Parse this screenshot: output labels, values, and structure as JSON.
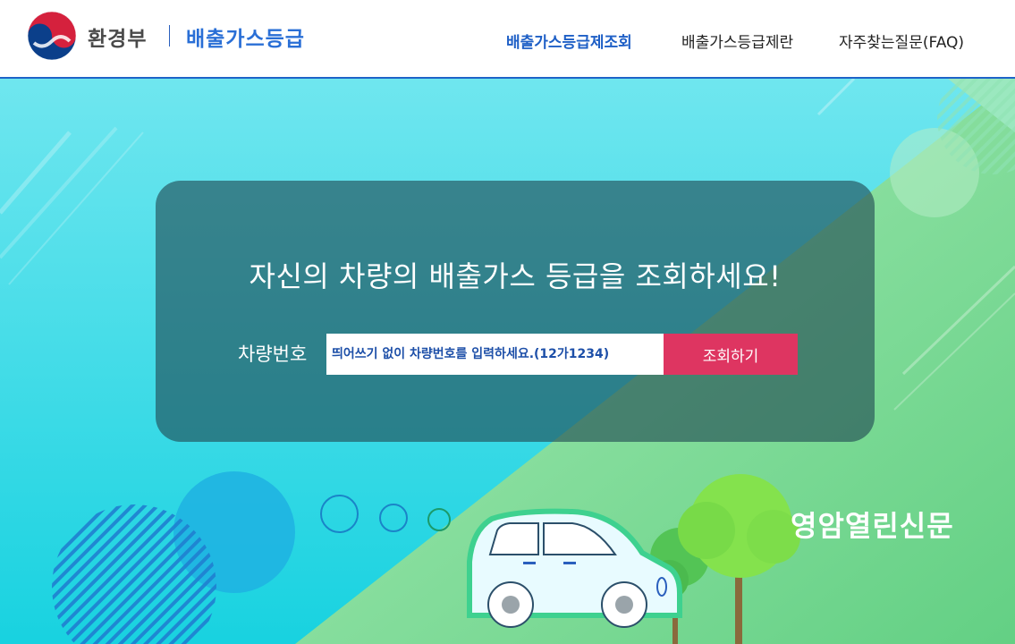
{
  "header": {
    "ministry_name": "환경부",
    "service_name": "배출가스등급",
    "nav": [
      {
        "label": "배출가스등급제조회",
        "active": true
      },
      {
        "label": "배출가스등급제란",
        "active": false
      },
      {
        "label": "자주찾는질문(FAQ)",
        "active": false
      }
    ]
  },
  "hero": {
    "headline": "자신의 차량의 배출가스 등급을 조회하세요!",
    "plate_label": "차량번호",
    "plate_placeholder": "띄어쓰기 없이 차량번호를 입력하세요.(12가1234)",
    "search_button": "조회하기"
  },
  "slider": {
    "dots": 3
  },
  "watermark": "영암열린신문",
  "colors": {
    "accent_blue": "#1e5fc6",
    "button_pink": "#de3561",
    "sky_cyan": "#2ad8e0",
    "grass_green": "#74d68e"
  },
  "icons": [
    "government-emblem-icon",
    "car-illustration",
    "tree-illustration"
  ]
}
